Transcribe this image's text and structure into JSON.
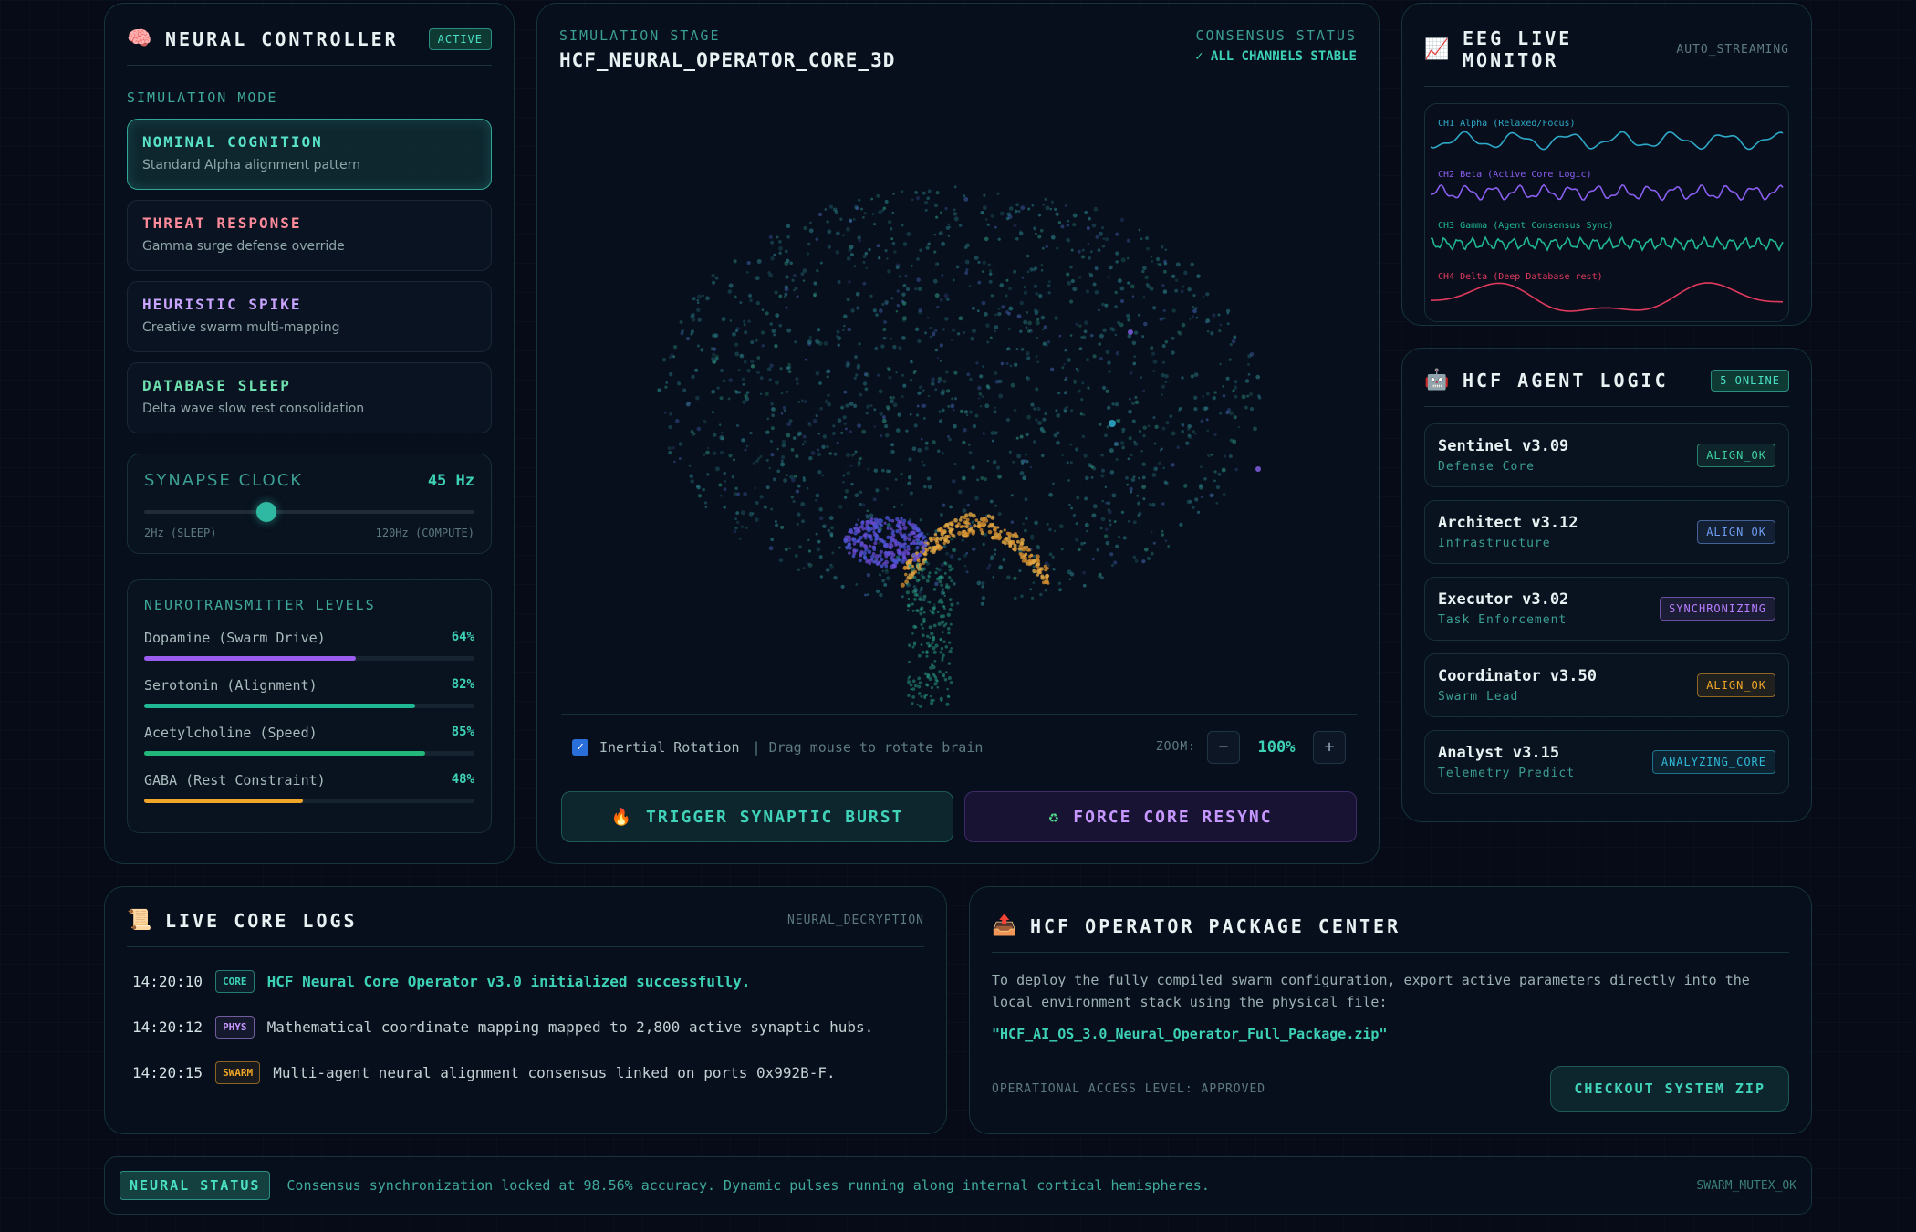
{
  "left": {
    "title": "NEURAL CONTROLLER",
    "badge": "ACTIVE",
    "mode_label": "SIMULATION MODE",
    "modes": [
      {
        "title": "NOMINAL COGNITION",
        "sub": "Standard Alpha alignment pattern",
        "color": "#58e2c8"
      },
      {
        "title": "THREAT RESPONSE",
        "sub": "Gamma surge defense override",
        "color": "#ff8a9a"
      },
      {
        "title": "HEURISTIC SPIKE",
        "sub": "Creative swarm multi-mapping",
        "color": "#c9a5ff"
      },
      {
        "title": "DATABASE SLEEP",
        "sub": "Delta wave slow rest consolidation",
        "color": "#6fe0b0"
      }
    ],
    "clock": {
      "label": "SYNAPSE CLOCK",
      "value": "45 Hz",
      "min": "2Hz (SLEEP)",
      "max": "120Hz (COMPUTE)",
      "level": 0.37
    },
    "neuro_label": "NEUROTRANSMITTER LEVELS",
    "neuro": [
      {
        "name": "Dopamine (Swarm Drive)",
        "pct": "64%",
        "level": 0.64,
        "color": "#9b5cf0"
      },
      {
        "name": "Serotonin (Alignment)",
        "pct": "82%",
        "level": 0.82,
        "color": "#20b893"
      },
      {
        "name": "Acetylcholine (Speed)",
        "pct": "85%",
        "level": 0.85,
        "color": "#22b67a"
      },
      {
        "name": "GABA (Rest Constraint)",
        "pct": "48%",
        "level": 0.48,
        "color": "#f0a628"
      }
    ]
  },
  "center": {
    "stage_label": "SIMULATION STAGE",
    "stage_title": "HCF_NEURAL_OPERATOR_CORE_3D",
    "consensus_label": "CONSENSUS STATUS",
    "consensus_value": "✓ ALL CHANNELS STABLE",
    "rotation_label": "Inertial Rotation",
    "hint": "| Drag mouse to rotate brain",
    "zoom_label": "ZOOM:",
    "zoom_value": "100%",
    "zoom_minus": "−",
    "zoom_plus": "+",
    "burst_label": "TRIGGER SYNAPTIC BURST",
    "resync_label": "FORCE CORE RESYNC"
  },
  "eeg": {
    "title": "EEG LIVE MONITOR",
    "badge": "AUTO_STREAMING",
    "channels": [
      {
        "label": "CH1 Alpha (Relaxed/Focus)",
        "color": "#2fa9c9"
      },
      {
        "label": "CH2 Beta (Active Core Logic)",
        "color": "#8a5ef0"
      },
      {
        "label": "CH3 Gamma (Agent Consensus Sync)",
        "color": "#20b893"
      },
      {
        "label": "CH4 Delta (Deep Database rest)",
        "color": "#e03a5e"
      }
    ]
  },
  "agents": {
    "title": "HCF AGENT LOGIC",
    "badge": "5 ONLINE",
    "list": [
      {
        "name": "Sentinel v3.09",
        "role": "Defense Core",
        "status": "ALIGN_OK",
        "color": "#3dd1a0"
      },
      {
        "name": "Architect v3.12",
        "role": "Infrastructure",
        "status": "ALIGN_OK",
        "color": "#6d9cf0"
      },
      {
        "name": "Executor v3.02",
        "role": "Task Enforcement",
        "status": "SYNCHRONIZING",
        "color": "#b77cff"
      },
      {
        "name": "Coordinator v3.50",
        "role": "Swarm Lead",
        "status": "ALIGN_OK",
        "color": "#f0a628"
      },
      {
        "name": "Analyst v3.15",
        "role": "Telemetry Predict",
        "status": "ANALYZING_CORE",
        "color": "#2fb9d9"
      }
    ]
  },
  "logs": {
    "title": "LIVE CORE LOGS",
    "badge": "NEURAL_DECRYPTION",
    "rows": [
      {
        "time": "14:20:10",
        "tag": "CORE",
        "msg": "HCF Neural Core Operator v3.0 initialized successfully.",
        "color": "#3dd1b6",
        "bright": true
      },
      {
        "time": "14:20:12",
        "tag": "PHYS",
        "msg": "Mathematical coordinate mapping mapped to 2,800 active synaptic hubs.",
        "color": "#c597ff",
        "bright": false
      },
      {
        "time": "14:20:15",
        "tag": "SWARM",
        "msg": "Multi-agent neural alignment consensus linked on ports 0x992B-F.",
        "color": "#f0a628",
        "bright": false
      }
    ]
  },
  "package": {
    "title": "HCF OPERATOR PACKAGE CENTER",
    "desc": "To deploy the fully compiled swarm configuration, export active parameters directly into the local environment stack using the physical file:",
    "file": "\"HCF_AI_OS_3.0_Neural_Operator_Full_Package.zip\"",
    "access": "OPERATIONAL ACCESS LEVEL: APPROVED",
    "button": "CHECKOUT SYSTEM ZIP"
  },
  "status": {
    "badge": "NEURAL STATUS",
    "message": "Consensus synchronization locked at 98.56% accuracy. Dynamic pulses running along internal cortical hemispheres.",
    "right": "SWARM_MUTEX_OK"
  },
  "icons": {
    "brain": "brain-icon",
    "chart": "chart-increasing-icon",
    "robot": "robot-icon",
    "scroll": "scroll-icon",
    "package": "outbox-tray-icon",
    "fire": "fire-icon",
    "recycle": "recycle-icon",
    "check": "check-icon"
  }
}
